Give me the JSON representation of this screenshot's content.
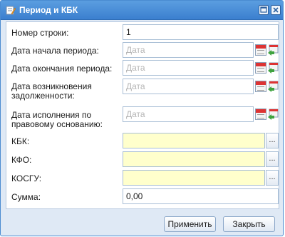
{
  "window": {
    "title": "Период и КБК",
    "icon": "form-edit-icon"
  },
  "fields": [
    {
      "label": "Номер строки:",
      "value": "1",
      "placeholder": ""
    },
    {
      "label": "Дата начала периода:",
      "value": "",
      "placeholder": "Дата"
    },
    {
      "label": "Дата окончания периода:",
      "value": "",
      "placeholder": "Дата"
    },
    {
      "label_line1": "Дата возникновения",
      "label_line2": "задолженности:",
      "value": "",
      "placeholder": "Дата"
    },
    {
      "label_line1": "Дата исполнения по",
      "label_line2": "правовому основанию:",
      "value": "",
      "placeholder": "Дата"
    },
    {
      "label": "КБК:",
      "value": "",
      "lookup": "..."
    },
    {
      "label": "КФО:",
      "value": "",
      "lookup": "..."
    },
    {
      "label": "КОСГУ:",
      "value": "",
      "lookup": "..."
    },
    {
      "label": "Сумма:",
      "value": "0,00"
    }
  ],
  "buttons": {
    "apply": "Применить",
    "close": "Закрыть"
  },
  "colors": {
    "title_bar": "#3b7fcf",
    "required_field": "#ffffcc"
  }
}
